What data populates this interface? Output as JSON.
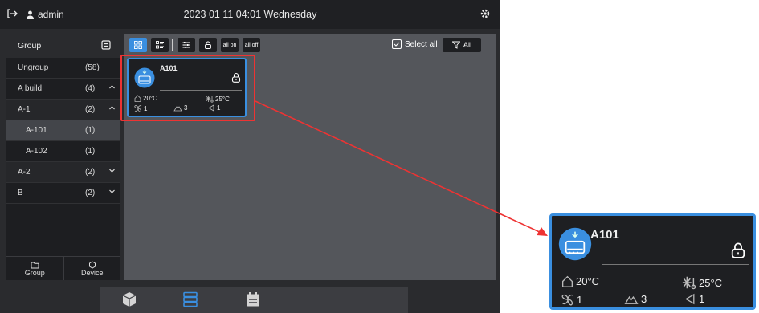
{
  "topbar": {
    "user": "admin",
    "datetime": "2023 01 11 04:01 Wednesday"
  },
  "sidebar": {
    "header": "Group",
    "items": [
      {
        "label": "Ungroup",
        "count": "(58)"
      },
      {
        "label": "A build",
        "count": "(4)"
      },
      {
        "label": "A-1",
        "count": "(2)"
      },
      {
        "label": "A-101",
        "count": "(1)"
      },
      {
        "label": "A-102",
        "count": "(1)"
      },
      {
        "label": "A-2",
        "count": "(2)"
      },
      {
        "label": "B",
        "count": "(2)"
      }
    ],
    "bottom": {
      "group_label": "Group",
      "device_label": "Device"
    }
  },
  "toolbar": {
    "all_on": "all on",
    "all_off": "all off",
    "select_all": "Select all",
    "filter": "All"
  },
  "card": {
    "name": "A101",
    "indoor_temp": "20°C",
    "set_temp": "25°C",
    "fan": "1",
    "swing": "3",
    "louver": "1"
  },
  "colors": {
    "accent": "#3a8fe0",
    "highlight": "#e33333"
  }
}
